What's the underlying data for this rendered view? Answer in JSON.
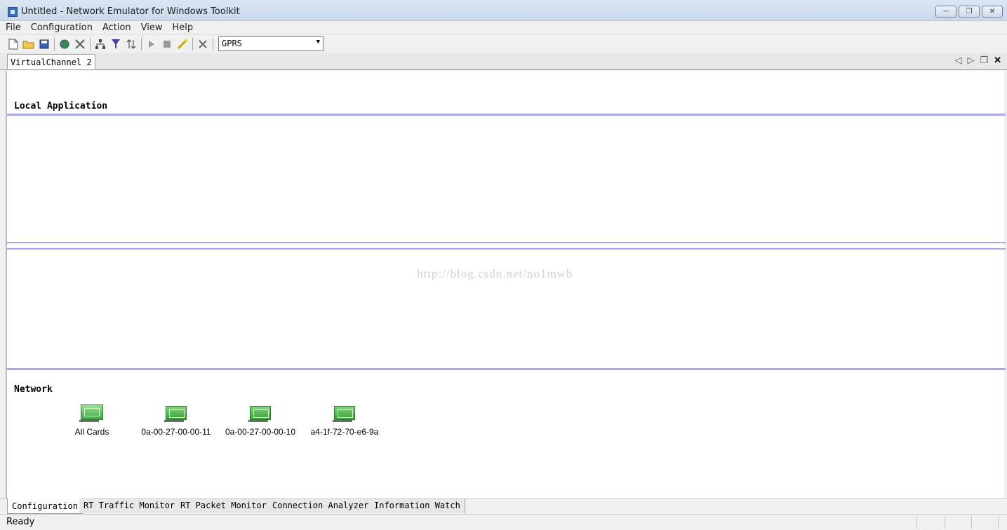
{
  "window": {
    "title": "Untitled - Network Emulator for Windows Toolkit"
  },
  "menu": {
    "items": [
      "File",
      "Configuration",
      "Action",
      "View",
      "Help"
    ]
  },
  "toolbar": {
    "icons": [
      "new-file-icon",
      "open-folder-icon",
      "save-icon",
      "globe-icon",
      "tools-icon",
      "network-topology-icon",
      "filter-icon",
      "sort-icon",
      "play-icon",
      "stop-icon",
      "wizard-icon",
      "delete-icon"
    ],
    "profile_select": {
      "value": "GPRS"
    }
  },
  "document_tabs": {
    "active": "VirtualChannel 2"
  },
  "sections": {
    "local_application": "Local Application",
    "network": "Network"
  },
  "watermark": "http://blog.csdn.net/no1mwb",
  "network_cards": [
    {
      "label": "All Cards"
    },
    {
      "label": "0a-00-27-00-00-11"
    },
    {
      "label": "0a-00-27-00-00-10"
    },
    {
      "label": "a4-1f-72-70-e6-9a"
    }
  ],
  "bottom_tabs": [
    "Configuration",
    "RT Traffic Monitor",
    "RT Packet Monitor",
    "Connection Analyzer",
    "Information Watch"
  ],
  "status": {
    "text": "Ready"
  },
  "colors": {
    "section_rule": "#a9a6ec",
    "card_green": "#44a544"
  }
}
